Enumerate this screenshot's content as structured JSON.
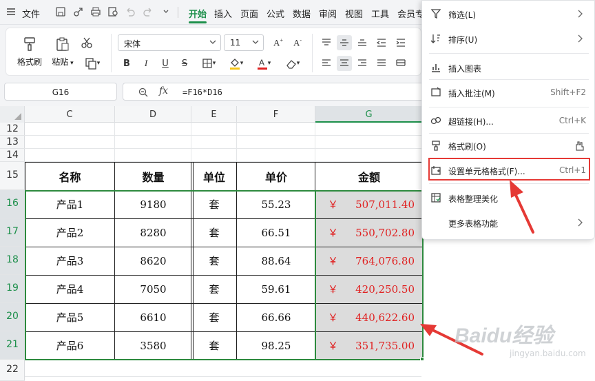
{
  "menubar": {
    "file": "文件",
    "tabs": [
      "开始",
      "插入",
      "页面",
      "公式",
      "数据",
      "审阅",
      "视图",
      "工具",
      "会员专"
    ]
  },
  "ribbon": {
    "format_painter": "格式刷",
    "paste": "粘贴",
    "font_name": "宋体",
    "font_size": "11",
    "bold": "B",
    "italic": "I",
    "underline": "U",
    "strike": "S",
    "font_color": "#e02020"
  },
  "formula_bar": {
    "cell_ref": "G16",
    "fx": "fx",
    "formula": "=F16*D16"
  },
  "columns": [
    "C",
    "D",
    "E",
    "F",
    "G"
  ],
  "rows": [
    "12",
    "13",
    "14",
    "15",
    "16",
    "17",
    "18",
    "19",
    "20",
    "21",
    "22"
  ],
  "table": {
    "headers": [
      "名称",
      "数量",
      "单位",
      "单价",
      "金额"
    ],
    "rows": [
      {
        "name": "产品1",
        "qty": "9180",
        "unit": "套",
        "price": "55.23",
        "currency": "￥",
        "amount": "507,011.40"
      },
      {
        "name": "产品2",
        "qty": "8280",
        "unit": "套",
        "price": "66.51",
        "currency": "￥",
        "amount": "550,702.80"
      },
      {
        "name": "产品3",
        "qty": "8620",
        "unit": "套",
        "price": "88.64",
        "currency": "￥",
        "amount": "764,076.80"
      },
      {
        "name": "产品4",
        "qty": "7050",
        "unit": "套",
        "price": "59.61",
        "currency": "￥",
        "amount": "420,250.50"
      },
      {
        "name": "产品5",
        "qty": "6610",
        "unit": "套",
        "price": "66.66",
        "currency": "￥",
        "amount": "440,622.60"
      },
      {
        "name": "产品6",
        "qty": "3580",
        "unit": "套",
        "price": "98.25",
        "currency": "￥",
        "amount": "351,735.00"
      }
    ]
  },
  "context_menu": {
    "items": [
      {
        "label": "筛选(L)",
        "icon": "filter-icon",
        "submenu": true
      },
      {
        "label": "排序(U)",
        "icon": "sort-icon",
        "submenu": true
      },
      {
        "label": "插入图表",
        "icon": "chart-icon"
      },
      {
        "label": "插入批注(M)",
        "icon": "comment-icon",
        "shortcut": "Shift+F2"
      },
      {
        "label": "超链接(H)...",
        "icon": "link-icon",
        "shortcut": "Ctrl+K"
      },
      {
        "label": "格式刷(O)",
        "icon": "format-painter-icon"
      },
      {
        "label": "设置单元格格式(F)...",
        "icon": "cell-format-icon",
        "shortcut": "Ctrl+1"
      },
      {
        "label": "表格整理美化",
        "icon": "beautify-icon"
      },
      {
        "label": "更多表格功能",
        "icon": "",
        "submenu": true
      }
    ]
  },
  "watermark": {
    "brand": "Baidu经验",
    "url": "jingyan.baidu.com"
  },
  "colors": {
    "accent_green": "#1c8f4a",
    "highlight_red": "#e53935",
    "amount_red": "#e02020"
  }
}
